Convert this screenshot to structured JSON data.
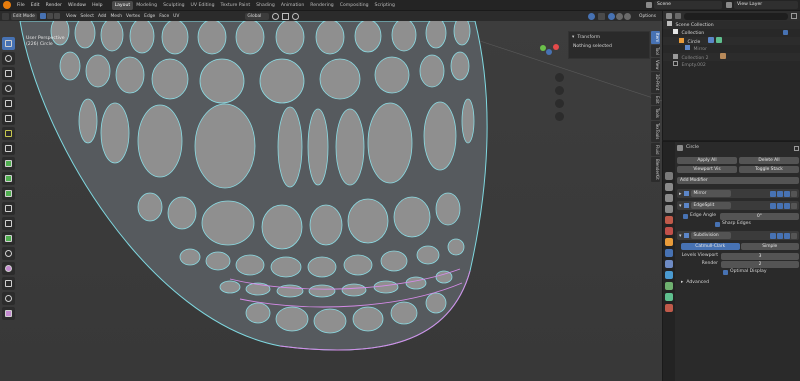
{
  "topbar": {
    "menus": [
      "File",
      "Edit",
      "Render",
      "Window",
      "Help"
    ],
    "workspace_tabs": [
      "Layout",
      "Modeling",
      "Sculpting",
      "UV Editing",
      "Texture Paint",
      "Shading",
      "Animation",
      "Rendering",
      "Compositing",
      "Scripting"
    ],
    "active_tab": "Layout",
    "scene": "Scene",
    "view_layer": "View Layer"
  },
  "viewport_header": {
    "mode": "Edit Mode",
    "menus": [
      "View",
      "Select",
      "Add",
      "Mesh",
      "Vertex",
      "Edge",
      "Face",
      "UV"
    ],
    "orientation": "Global",
    "pivot_label": "Models",
    "options": "Options"
  },
  "viewport": {
    "view_name": "User Perspective",
    "object_info": "(226) Circle"
  },
  "npanel": {
    "section": "Transform",
    "message": "Nothing selected",
    "tabs": [
      "Item",
      "Tool",
      "View",
      "3D-Print",
      "Edit",
      "Tools",
      "TexTools",
      "Fluid",
      "BlenderKit"
    ]
  },
  "outliner": {
    "rows": [
      {
        "label": "Scene Collection",
        "indent": 0
      },
      {
        "label": "Collection",
        "indent": 1
      },
      {
        "label": "Circle",
        "indent": 2
      },
      {
        "label": "Mirror",
        "indent": 3
      },
      {
        "label": "Collection 2",
        "indent": 1
      },
      {
        "label": "Empty.002",
        "indent": 1
      }
    ]
  },
  "properties": {
    "object_name": "Circle",
    "apply_all": "Apply All",
    "delete_all": "Delete All",
    "viewport_vis": "Viewport Vis",
    "toggle_stack": "Toggle Stack",
    "add_modifier": "Add Modifier",
    "modifiers": [
      {
        "name": "Mirror"
      },
      {
        "name": "EdgeSplit",
        "edge_angle_label": "Edge Angle",
        "edge_angle_value": "0°",
        "sharp_edges": "Sharp Edges"
      },
      {
        "name": "Subdivision",
        "mode_a": "Catmull-Clark",
        "mode_b": "Simple",
        "levels_viewport_label": "Levels Viewport",
        "levels_viewport": "3",
        "render_label": "Render",
        "render": "2",
        "optimal_display": "Optimal Display",
        "advanced": "Advanced"
      }
    ]
  },
  "colors": {
    "accent": "#4772b3",
    "wire_edge": "#7fd8e0",
    "wire_edge_pink": "#d58be8",
    "face_fill": "#8e8e8e"
  }
}
